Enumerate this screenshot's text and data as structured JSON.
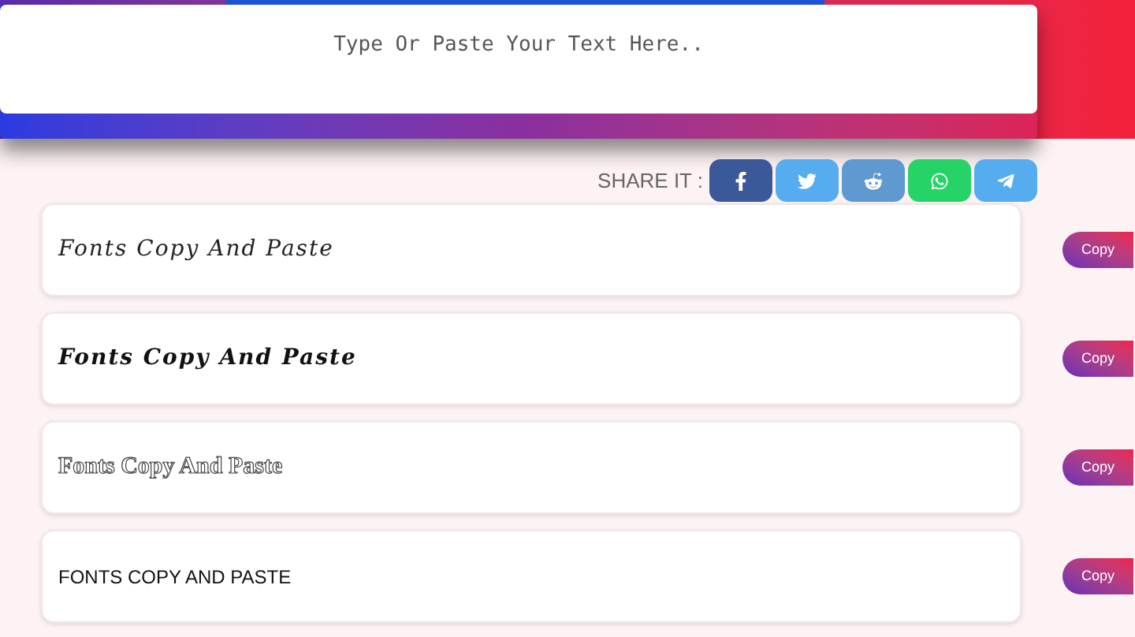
{
  "input": {
    "placeholder": "Type Or Paste Your Text Here.."
  },
  "share": {
    "label": "SHARE IT :",
    "buttons": [
      {
        "kind": "facebook"
      },
      {
        "kind": "twitter"
      },
      {
        "kind": "reddit"
      },
      {
        "kind": "whatsapp"
      },
      {
        "kind": "telegram"
      }
    ]
  },
  "fonts": [
    {
      "kind": "script",
      "text": "Fonts Copy And Paste",
      "button": "Copy"
    },
    {
      "kind": "script-bold",
      "text": "Fonts Copy And Paste",
      "button": "Copy"
    },
    {
      "kind": "outline-serif",
      "text": "Fonts Copy And Paste",
      "button": "Copy"
    },
    {
      "kind": "caps",
      "text": "FONTS COPY AND PASTE",
      "button": "Copy"
    }
  ]
}
